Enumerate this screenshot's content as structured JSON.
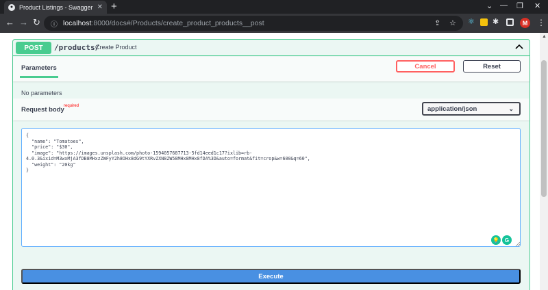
{
  "browser": {
    "tab_title": "Product Listings - Swagger UI",
    "tab_close": "✕",
    "new_tab": "+",
    "url_host": "localhost",
    "url_path": ":8000/docs#/Products/create_product_products__post",
    "profile_initial": "M",
    "icons": {
      "back": "arrow-left-icon",
      "forward": "arrow-right-icon",
      "reload": "reload-icon",
      "info": "site-info-icon",
      "share": "share-icon",
      "bookmark": "star-icon",
      "extensions": "puzzle-icon",
      "menu": "kebab-icon"
    }
  },
  "operation": {
    "method": "POST",
    "path": "/products/",
    "summary": "Create Product"
  },
  "parameters": {
    "title": "Parameters",
    "cancel_label": "Cancel",
    "reset_label": "Reset",
    "empty_text": "No parameters"
  },
  "request_body": {
    "title": "Request body",
    "required_label": "required",
    "content_type": "application/json",
    "body_text": "{\n  \"name\": \"Tomatoes\",\n  \"price\": \"$30\",\n  \"image\": \"https://images.unsplash.com/photo-1594057687713-5fd14eed1c17?ixlib=rb-\n4.0.3&ixid=M3wxMjA3fDB8MHxzZWFyY2h8OHx8dG9tYXRvZXN8ZW58MHx8MHx8fDA%3D&auto=format&fit=crop&w=600&q=60\",\n  \"weight\": \"20kg\"\n}"
  },
  "execute_label": "Execute",
  "colors": {
    "post_green": "#49cc90",
    "execute_blue": "#4990e2",
    "cancel_red": "#ff6060"
  }
}
